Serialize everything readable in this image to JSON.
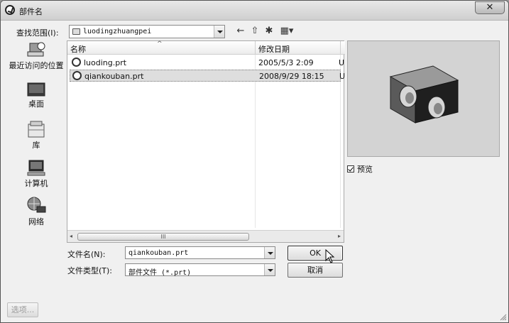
{
  "window": {
    "title": "部件名",
    "close": "✕"
  },
  "lookin": {
    "label": "查找范围(I):",
    "value": "luodingzhuangpei"
  },
  "toolbar": {
    "back": "←",
    "up": "⇧",
    "newfolder": "✱",
    "views": "▦▾"
  },
  "places": [
    {
      "label": "最近访问的位置",
      "icon": "recent-places-icon"
    },
    {
      "label": "桌面",
      "icon": "desktop-icon"
    },
    {
      "label": "库",
      "icon": "libraries-icon"
    },
    {
      "label": "计算机",
      "icon": "computer-icon"
    },
    {
      "label": "网络",
      "icon": "network-icon"
    }
  ],
  "list": {
    "columns": [
      "名称",
      "修改日期",
      ""
    ],
    "sort_indicator": "^",
    "rows": [
      {
        "name": "luoding.prt",
        "date": "2005/5/3 2:09",
        "type": "U"
      },
      {
        "name": "qiankouban.prt",
        "date": "2008/9/29 18:15",
        "type": "U"
      }
    ],
    "scroll_left": "◂",
    "scroll_right": "▸",
    "scroll_grip": "III"
  },
  "preview": {
    "checkbox_label": "预览",
    "checked": true
  },
  "filename": {
    "label": "文件名(N):",
    "value": "qiankouban.prt"
  },
  "filetype": {
    "label": "文件类型(T):",
    "value": "部件文件 (*.prt)"
  },
  "buttons": {
    "ok": "OK",
    "cancel": "取消",
    "options": "选项..."
  },
  "colors": {
    "titlebar": "#d8d8d8",
    "window_bg": "#f0f0f0",
    "selection": "#dedede",
    "preview_bg": "#d3d3d3"
  }
}
